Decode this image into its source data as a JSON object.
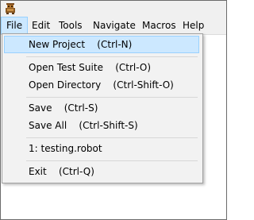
{
  "menubar": {
    "items": [
      "File",
      "Edit",
      "Tools",
      "Navigate",
      "Macros",
      "Help"
    ],
    "active_index": 0
  },
  "file_menu": {
    "items": [
      "New Project    (Ctrl-N)",
      "Open Test Suite    (Ctrl-O)",
      "Open Directory    (Ctrl-Shift-O)",
      "Save    (Ctrl-S)",
      "Save All    (Ctrl-Shift-S)",
      "1: testing.robot",
      "Exit    (Ctrl-Q)"
    ],
    "highlighted_index": 0
  },
  "icons": {
    "app": "robot-app-icon"
  },
  "colors": {
    "menu_highlight": "#cce8ff",
    "menu_highlight_border": "#99d1ff",
    "menubar_bg": "#f0f0f0",
    "dropdown_bg": "#f2f2f2"
  }
}
